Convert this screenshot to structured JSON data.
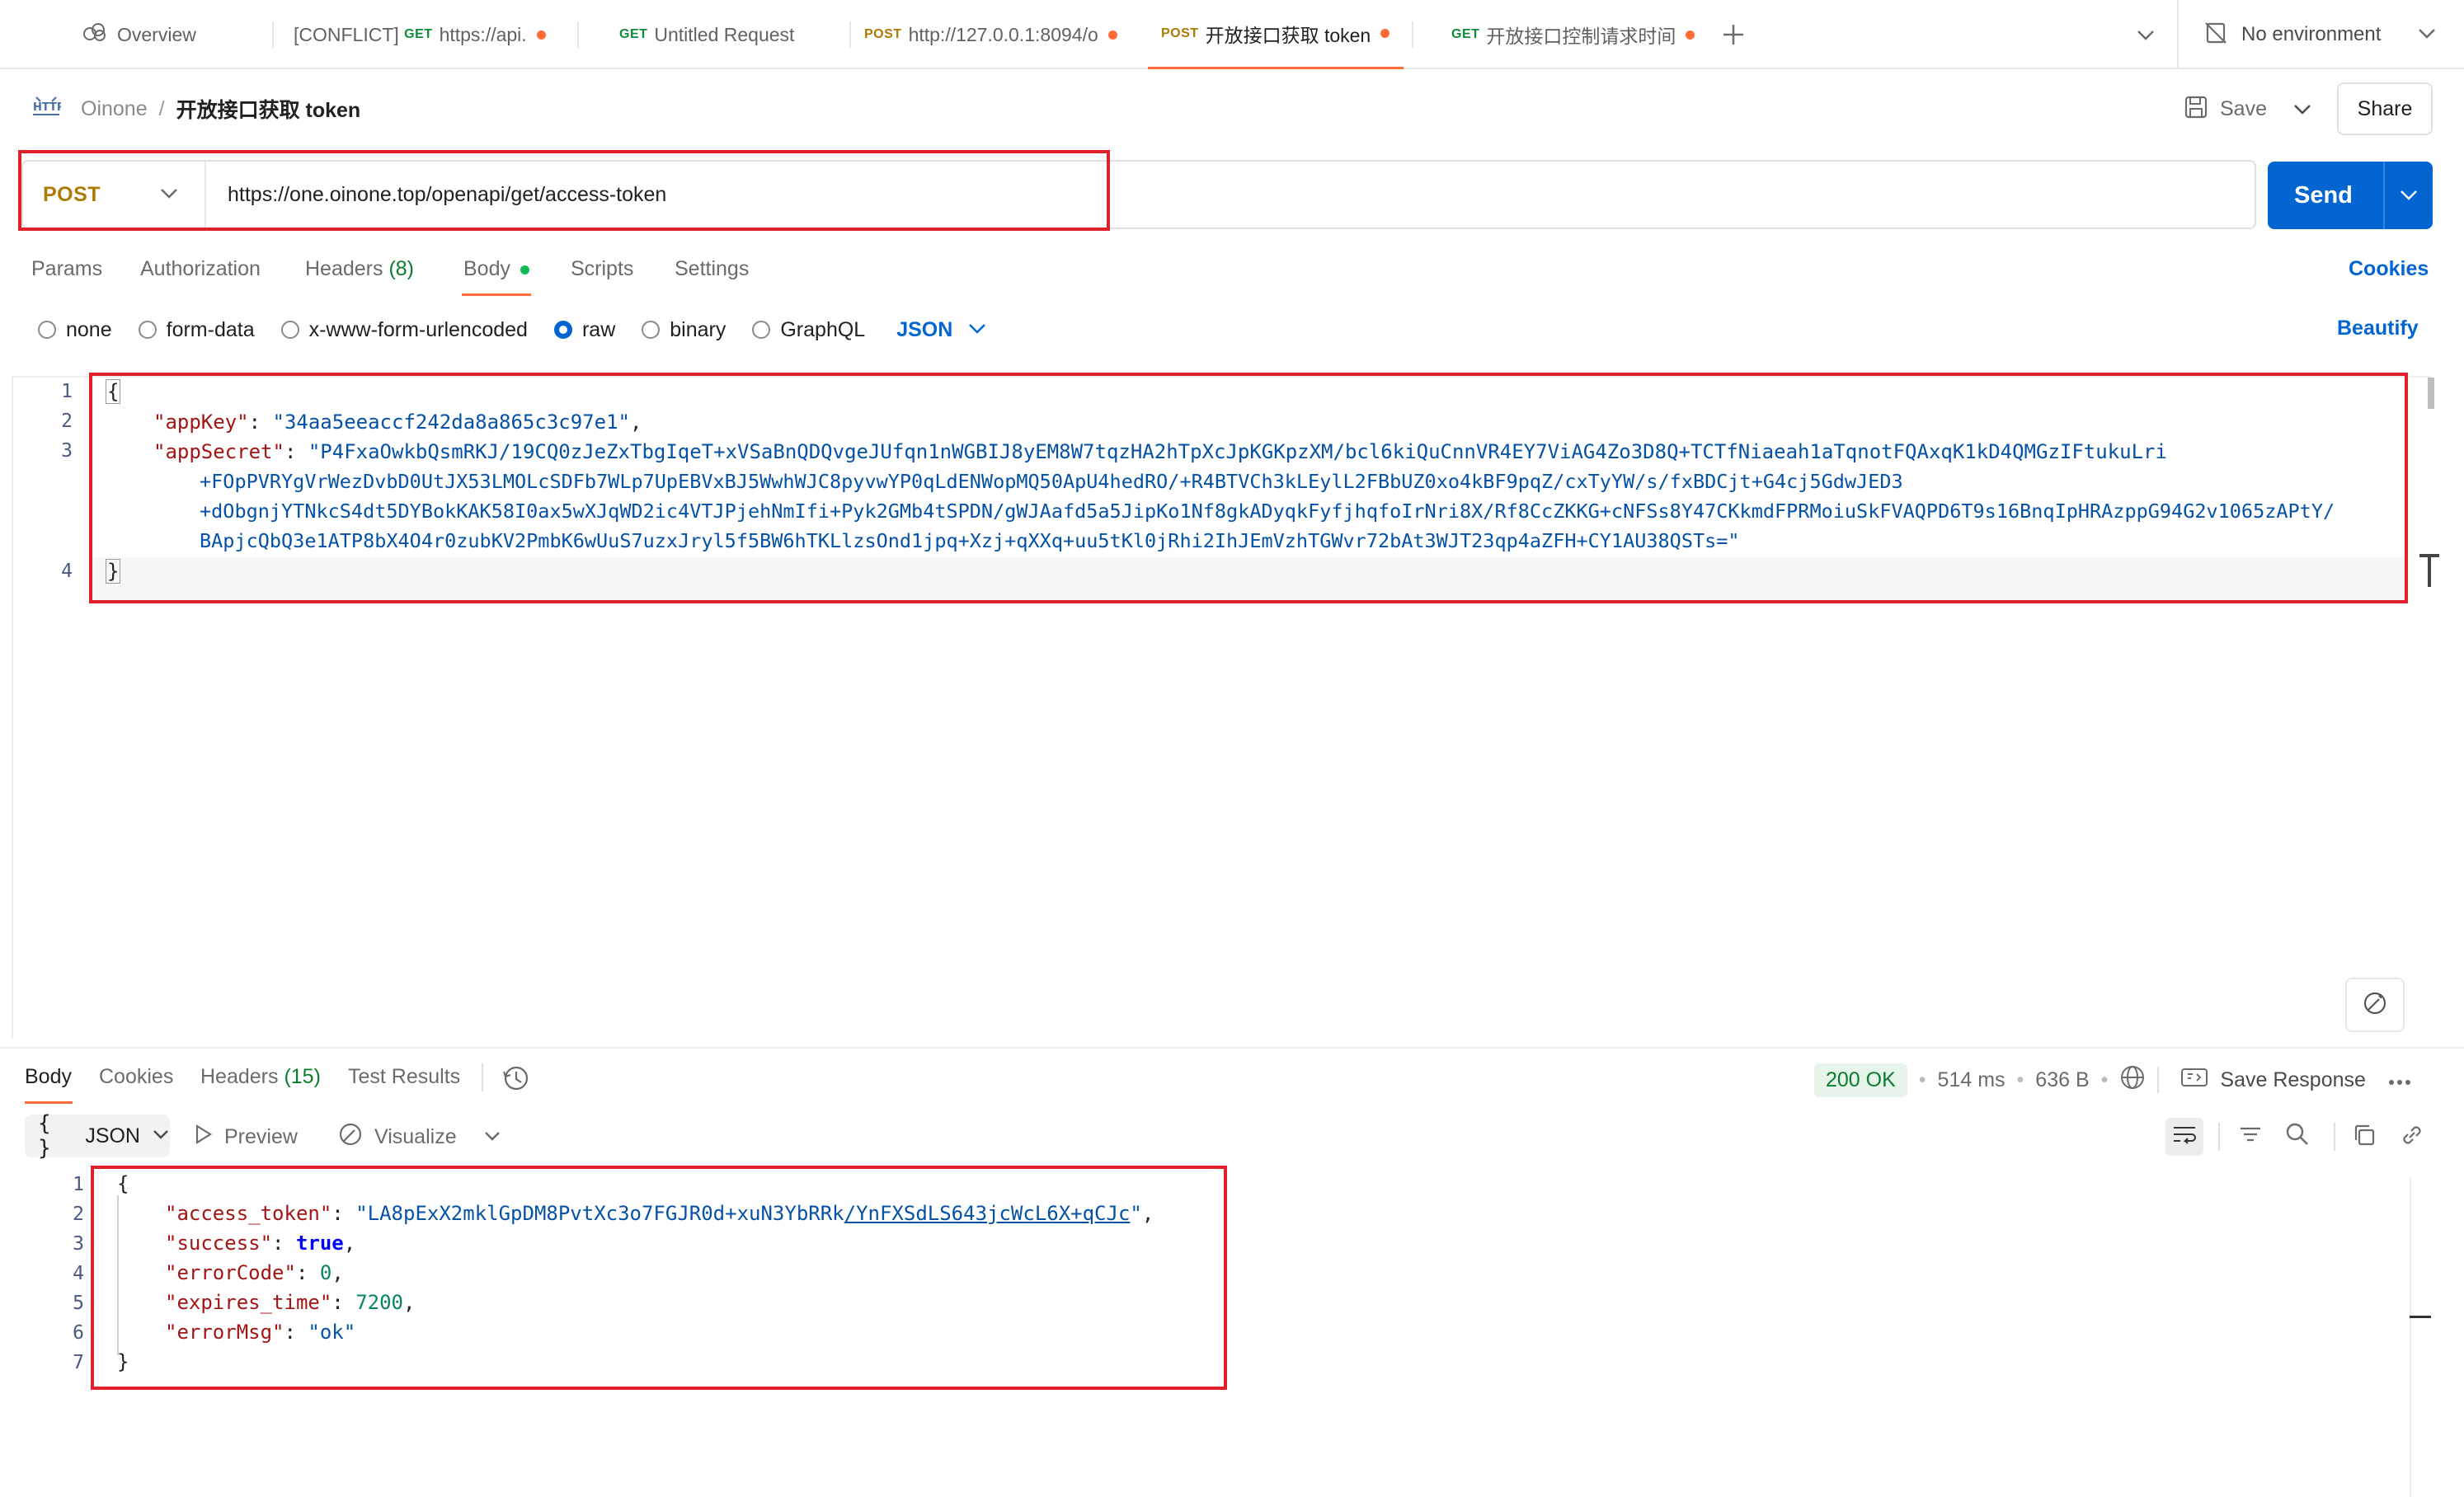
{
  "tabs": [
    {
      "label": "Overview",
      "method": "",
      "dot": false
    },
    {
      "label": "[CONFLICT] ",
      "method": "GET",
      "suffix": "https://api.",
      "dot": true
    },
    {
      "label": "",
      "method": "GET",
      "suffix": "Untitled Request",
      "dot": false
    },
    {
      "label": "",
      "method": "POST",
      "suffix": "http://127.0.0.1:8094/o",
      "dot": true
    },
    {
      "label": "",
      "method": "POST",
      "suffix": "开放接口获取 token",
      "dot": true
    },
    {
      "label": "",
      "method": "GET",
      "suffix": "开放接口控制请求时间",
      "dot": true
    }
  ],
  "environment": "No environment",
  "breadcrumb": {
    "collection": "Oinone",
    "separator": "/",
    "request": "开放接口获取 token",
    "http_badge": "HTTP"
  },
  "actions": {
    "save": "Save",
    "share": "Share",
    "send": "Send"
  },
  "request": {
    "method": "POST",
    "url": "https://one.oinone.top/openapi/get/access-token"
  },
  "request_tabs": {
    "params": "Params",
    "authorization": "Authorization",
    "headers": "Headers",
    "headers_count": "(8)",
    "body": "Body",
    "scripts": "Scripts",
    "settings": "Settings",
    "cookies": "Cookies"
  },
  "body_types": {
    "none": "none",
    "form_data": "form-data",
    "urlencoded": "x-www-form-urlencoded",
    "raw": "raw",
    "binary": "binary",
    "graphql": "GraphQL",
    "format": "JSON",
    "beautify": "Beautify"
  },
  "request_body": {
    "line_numbers": [
      "1",
      "2",
      "3",
      "4"
    ],
    "open": "{",
    "close": "}",
    "app_key_key": "\"appKey\"",
    "app_key_value": "\"34aa5eeaccf242da8a865c3c97e1\"",
    "app_secret_key": "\"appSecret\"",
    "app_secret_lines": [
      "\"P4FxaOwkbQsmRKJ/19CQ0zJeZxTbgIqeT+xVSaBnQDQvgeJUfqn1nWGBIJ8yEM8W7tqzHA2hTpXcJpKGKpzXM/bcl6kiQuCnnVR4EY7ViAG4Zo3D8Q+TCTfNiaeah1aTqnotFQAxqK1kD4QMGzIFtukuLri",
      "+FOpPVRYgVrWezDvbD0UtJX53LMOLcSDFb7WLp7UpEBVxBJ5WwhWJC8pyvwYP0qLdENWopMQ50ApU4hedRO/+R4BTVCh3kLEylL2FBbUZ0xo4kBF9pqZ/cxTyYW/s/fxBDCjt+G4cj5GdwJED3",
      "+dObgnjYTNkcS4dt5DYBokKAK58I0ax5wXJqWD2ic4VTJPjehNmIfi+Pyk2GMb4tSPDN/gWJAafd5a5JipKo1Nf8gkADyqkFyfjhqfoIrNri8X/Rf8CcZKKG+cNFSs8Y47CKkmdFPRMoiuSkFVAQPD6T9s16BnqIpHRAzppG94G2v1065zAPtY/",
      "BApjcQbQ3e1ATP8bX4O4r0zubKV2PmbK6wUuS7uzxJryl5f5BW6hTKLlzsOnd1jpq+Xzj+qXXq+uu5tKl0jRhi2IhJEmVzhTGWvr72bAt3WJT23qp4aZFH+CY1AU38QSTs=\""
    ]
  },
  "response_tabs": {
    "body": "Body",
    "cookies": "Cookies",
    "headers": "Headers",
    "headers_count": "(15)",
    "test_results": "Test Results"
  },
  "response_meta": {
    "status": "200 OK",
    "time": "514 ms",
    "size": "636 B",
    "save_response": "Save Response"
  },
  "response_view": {
    "format_braces": "{ }",
    "format": "JSON",
    "preview": "Preview",
    "visualize": "Visualize"
  },
  "response_body": {
    "line_numbers": [
      "1",
      "2",
      "3",
      "4",
      "5",
      "6",
      "7"
    ],
    "open": "{",
    "close": "}",
    "access_token_key": "\"access_token\"",
    "access_token_a": "\"LA8pExX2mklGpDM8PvtXc3o7FGJR0d+xuN3YbRRk",
    "access_token_b": "/YnFXSdLS643jcWcL6X+qCJc",
    "access_token_c": "\"",
    "success_key": "\"success\"",
    "success_value": "true",
    "error_code_key": "\"errorCode\"",
    "error_code_value": "0",
    "expires_key": "\"expires_time\"",
    "expires_value": "7200",
    "error_msg_key": "\"errorMsg\"",
    "error_msg_value": "\"ok\""
  },
  "colors": {
    "accent": "#ff6c37",
    "send": "#0265d2",
    "status_bg": "#e6f4e9",
    "status_fg": "#0a7c2d",
    "highlight": "#e0202a"
  }
}
